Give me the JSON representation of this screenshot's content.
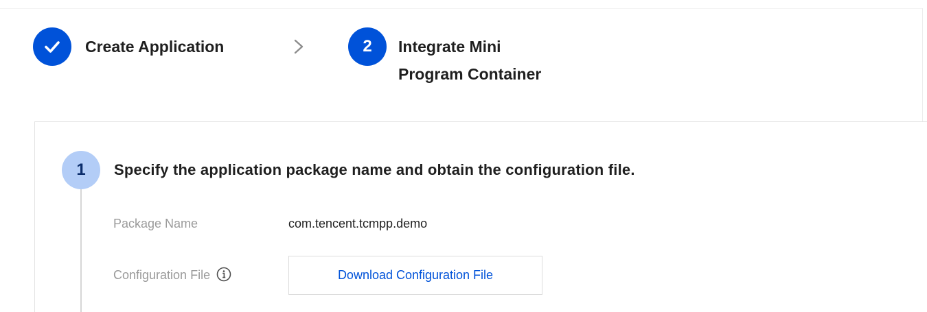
{
  "stepper": {
    "steps": [
      {
        "number": "",
        "label": "Create Application",
        "status": "completed"
      },
      {
        "number": "2",
        "label_line1": "Integrate Mini",
        "label_line2": "Program Container",
        "status": "active"
      }
    ],
    "separator_icon": "chevron-right-icon",
    "accent_color": "#0052d9"
  },
  "section": {
    "number": "1",
    "title": "Specify the application package name and obtain the configuration file.",
    "fields": {
      "package_name_label": "Package Name",
      "package_name_value": "com.tencent.tcmpp.demo",
      "configuration_file_label": "Configuration File",
      "download_button_label": "Download Configuration File"
    }
  }
}
